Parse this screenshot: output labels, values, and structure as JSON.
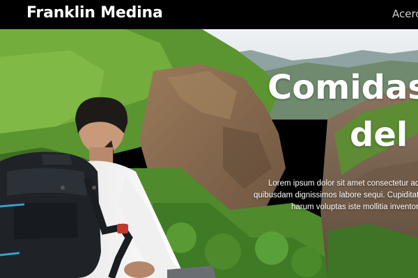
{
  "navbar": {
    "brand": "Franklin Medina",
    "links": [
      "Acerc"
    ]
  },
  "hero": {
    "title_line1": "Comidas",
    "title_line2": "del",
    "description_lines": [
      "Lorem ipsum dolor sit amet consectetur ad",
      "quibusdam dignissimos labore sequi. Cupiditate",
      "harum voluptas iste mollitia inventore"
    ]
  },
  "colors": {
    "navbar_bg": "#000000",
    "text": "#ffffff",
    "foliage": "#5f9a2e",
    "cliff": "#8a6a4a",
    "sky": "#dfe6ea"
  }
}
